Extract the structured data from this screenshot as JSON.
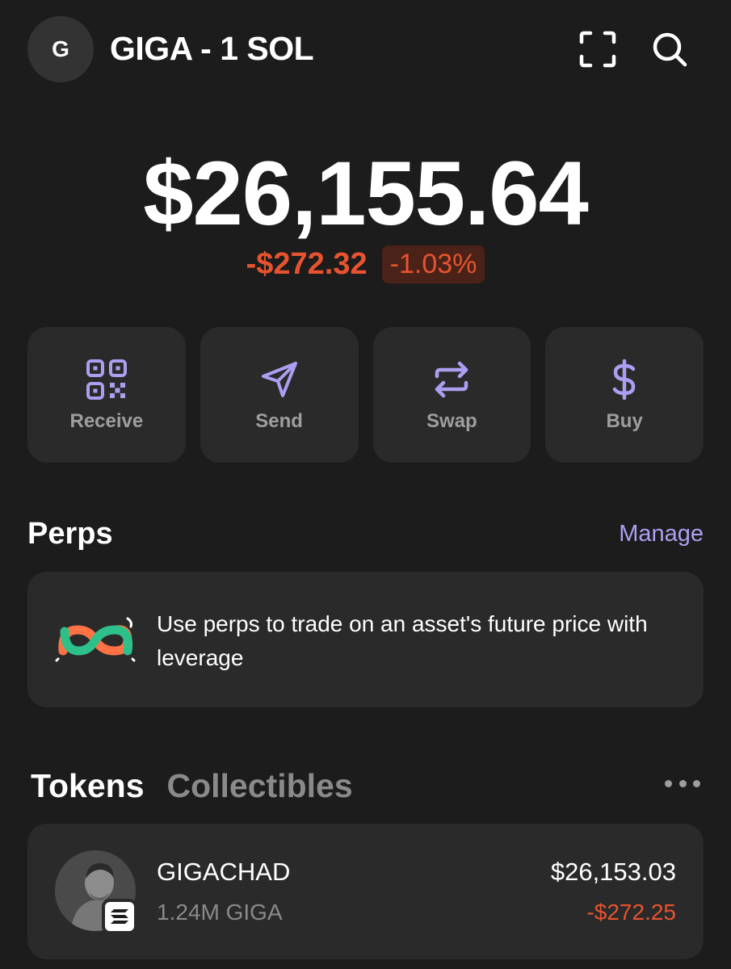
{
  "header": {
    "avatar_letter": "G",
    "account_name": "GIGA - 1 SOL"
  },
  "balance": {
    "total": "$26,155.64",
    "change_value": "-$272.32",
    "change_percent": "-1.03%"
  },
  "actions": [
    {
      "label": "Receive",
      "icon": "qr-code-icon"
    },
    {
      "label": "Send",
      "icon": "send-icon"
    },
    {
      "label": "Swap",
      "icon": "swap-icon"
    },
    {
      "label": "Buy",
      "icon": "dollar-icon"
    }
  ],
  "perps": {
    "title": "Perps",
    "manage_label": "Manage",
    "description": "Use perps to trade on an asset's future price with leverage"
  },
  "tabs": [
    {
      "label": "Tokens",
      "active": true
    },
    {
      "label": "Collectibles",
      "active": false
    }
  ],
  "tokens": [
    {
      "name": "GIGACHAD",
      "amount": "1.24M GIGA",
      "value": "$26,153.03",
      "change": "-$272.25"
    }
  ],
  "colors": {
    "background": "#1c1c1c",
    "card": "#2a2a2a",
    "accent": "#ab9ff2",
    "negative": "#e8532f"
  }
}
